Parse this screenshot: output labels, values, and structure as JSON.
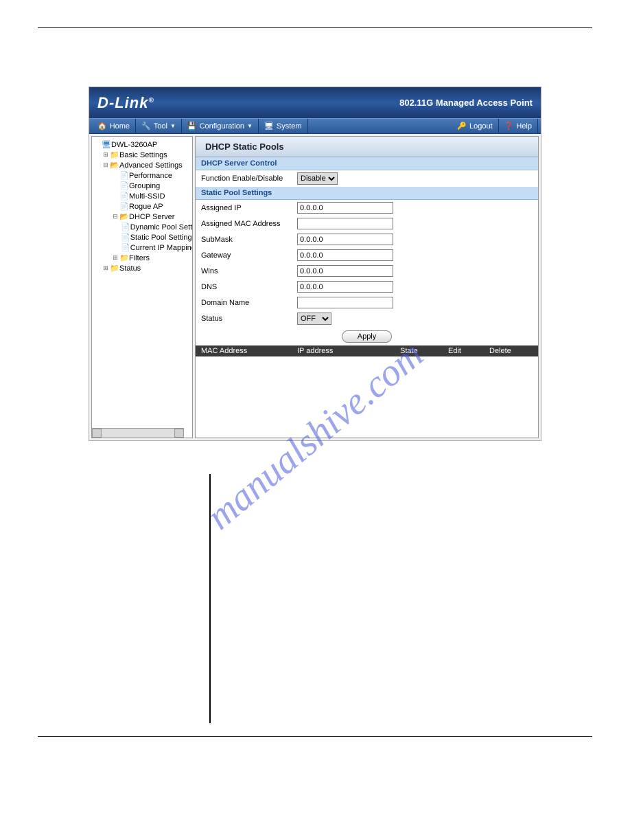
{
  "header": {
    "logo": "D-Link",
    "product": "802.11G Managed Access Point"
  },
  "menu": {
    "home": "Home",
    "tool": "Tool",
    "configuration": "Configuration",
    "system": "System",
    "logout": "Logout",
    "help": "Help"
  },
  "tree": {
    "root": "DWL-3260AP",
    "basic": "Basic Settings",
    "advanced": "Advanced Settings",
    "performance": "Performance",
    "grouping": "Grouping",
    "multissid": "Multi-SSID",
    "rogueap": "Rogue AP",
    "dhcpserver": "DHCP Server",
    "dynpool": "Dynamic Pool Setting",
    "staticpool": "Static Pool Setting",
    "currentip": "Current IP Mapping L",
    "filters": "Filters",
    "status": "Status"
  },
  "panel": {
    "title": "DHCP Static Pools",
    "section1": "DHCP Server Control",
    "function_label": "Function Enable/Disable",
    "function_value": "Disable",
    "section2": "Static Pool Settings",
    "assigned_ip_label": "Assigned IP",
    "assigned_ip_value": "0.0.0.0",
    "assigned_mac_label": "Assigned MAC Address",
    "assigned_mac_value": "",
    "submask_label": "SubMask",
    "submask_value": "0.0.0.0",
    "gateway_label": "Gateway",
    "gateway_value": "0.0.0.0",
    "wins_label": "Wins",
    "wins_value": "0.0.0.0",
    "dns_label": "DNS",
    "dns_value": "0.0.0.0",
    "domain_label": "Domain Name",
    "domain_value": "",
    "status_label": "Status",
    "status_value": "OFF",
    "apply": "Apply"
  },
  "table": {
    "mac": "MAC Address",
    "ip": "IP address",
    "state": "State",
    "edit": "Edit",
    "delete": "Delete"
  },
  "watermark": "manualshive.com"
}
